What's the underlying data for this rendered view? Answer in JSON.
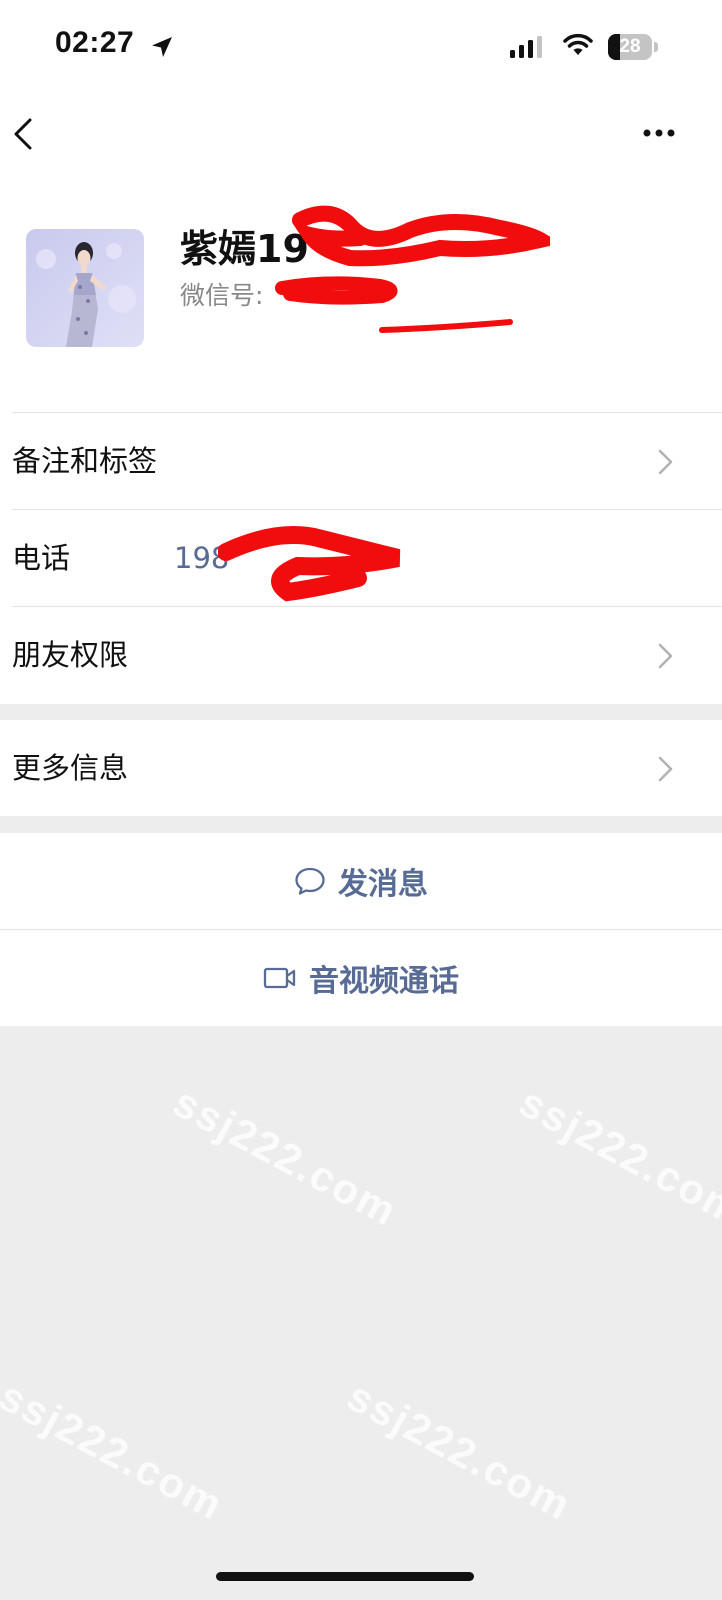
{
  "status_bar": {
    "time": "02:27",
    "battery_level": "28",
    "battery_fraction": 0.28,
    "icons": [
      "location-arrow-icon",
      "signal-icon",
      "wifi-icon",
      "battery-icon"
    ]
  },
  "nav": {
    "back_icon": "chevron-left-icon",
    "more_icon": "more-dots-icon"
  },
  "profile": {
    "name_visible": "紫嫣19",
    "wechat_id_label": "微信号:",
    "avatar": "profile-photo"
  },
  "rows": {
    "remarks_tags": "备注和标签",
    "phone_label": "电话",
    "phone_value_visible": "198",
    "friend_permissions": "朋友权限",
    "more_info": "更多信息"
  },
  "actions": {
    "send_message": "发消息",
    "send_message_icon": "chat-bubble-icon",
    "video_call": "音视频通话",
    "video_call_icon": "video-camera-icon"
  },
  "watermark_text": "ssj222.com",
  "colors": {
    "link_blue": "#576b95",
    "background_gray": "#ededed",
    "redaction_red": "#f10d0d"
  }
}
